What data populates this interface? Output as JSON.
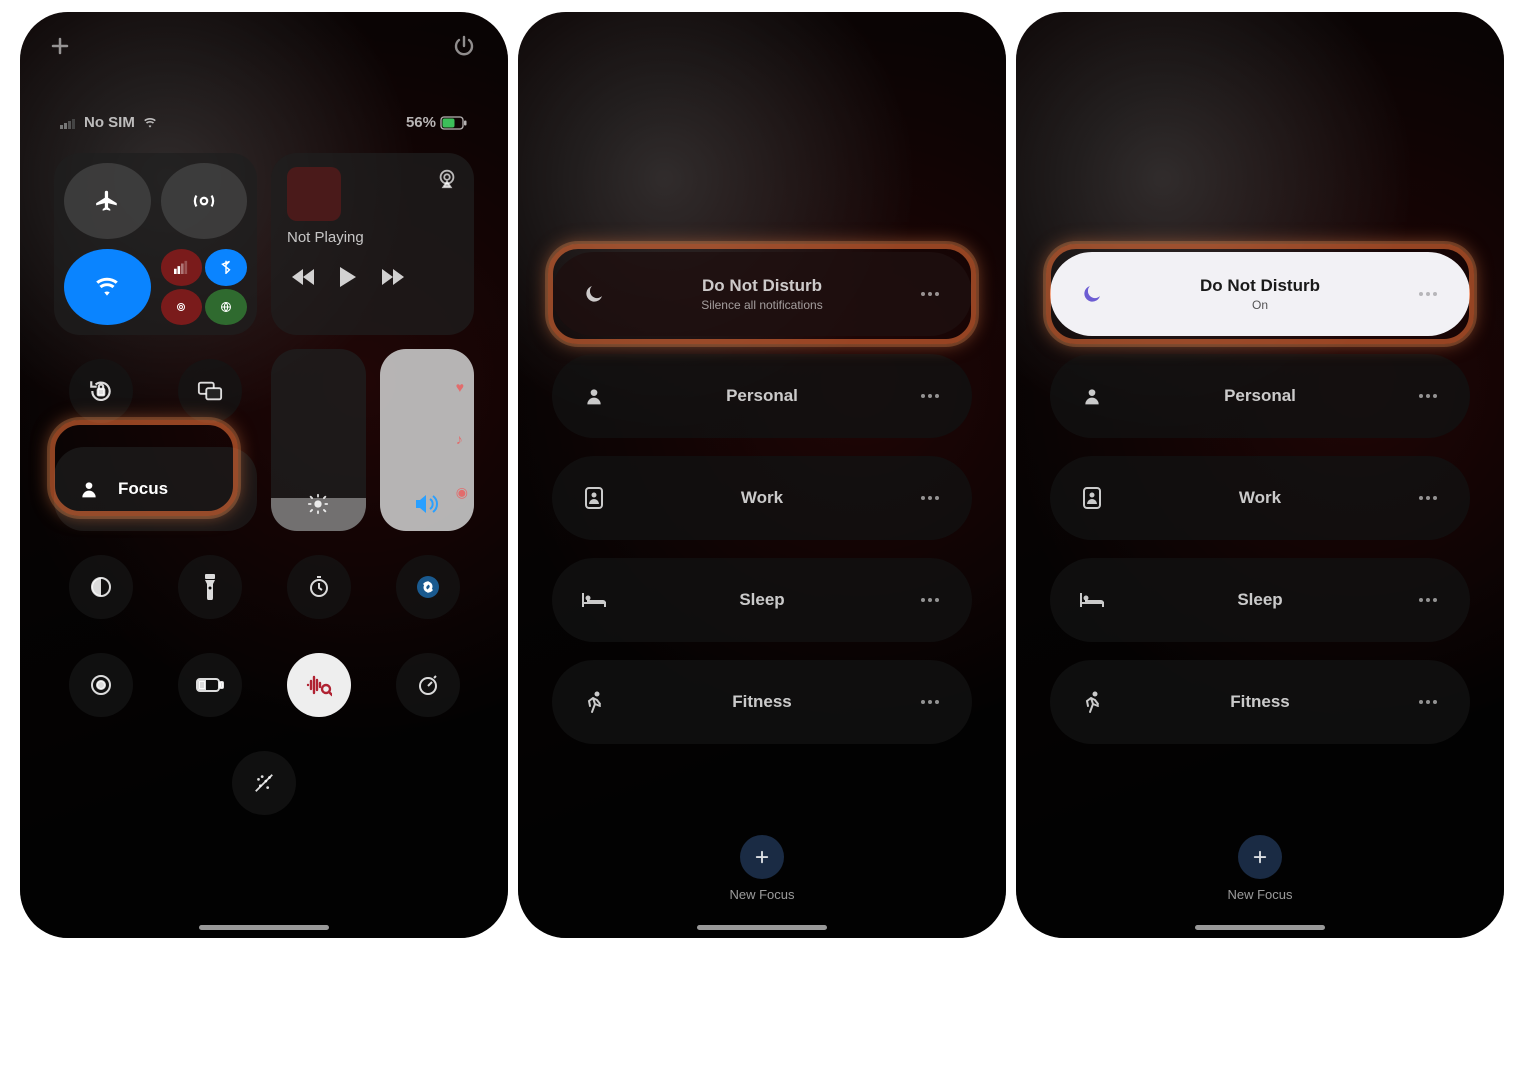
{
  "panel1": {
    "status": {
      "carrier": "No SIM",
      "battery": "56%"
    },
    "nowplaying": {
      "label": "Not Playing"
    },
    "focus_tile": {
      "label": "Focus"
    }
  },
  "focus_modes": {
    "dnd": {
      "title": "Do Not Disturb",
      "sub_off": "Silence all notifications",
      "sub_on": "On"
    },
    "personal": "Personal",
    "work": "Work",
    "sleep": "Sleep",
    "fitness": "Fitness",
    "new_focus": "New Focus"
  }
}
